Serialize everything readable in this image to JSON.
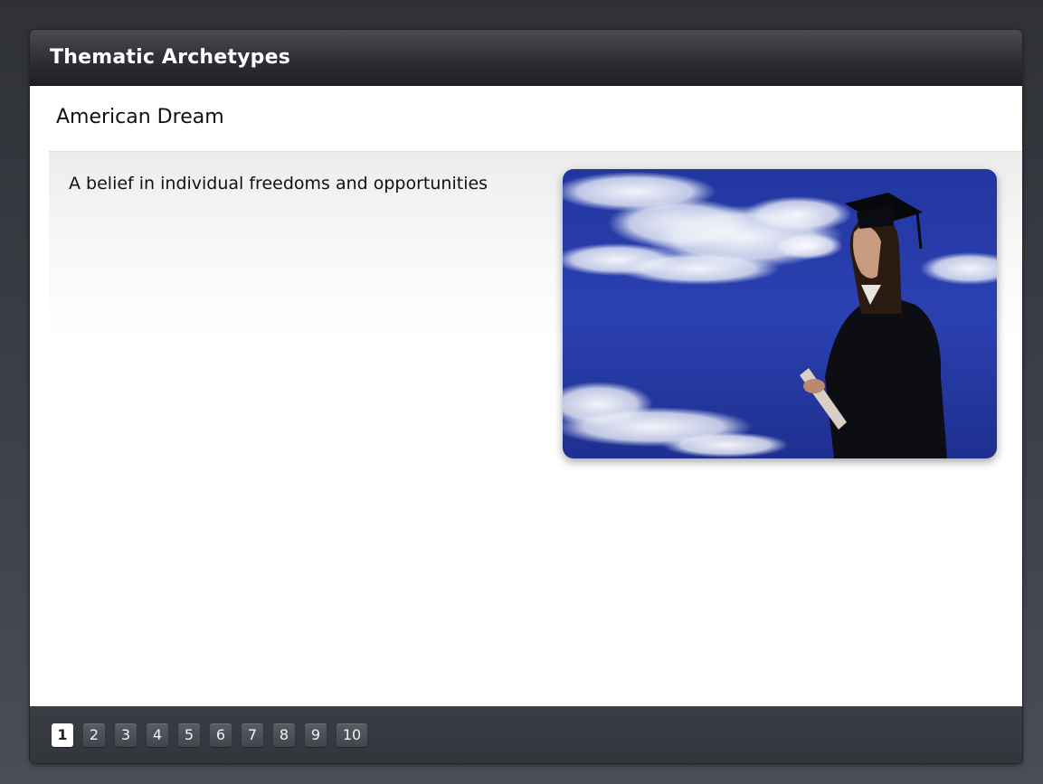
{
  "window": {
    "title": "Thematic Archetypes"
  },
  "slide": {
    "heading": "American Dream",
    "body": "A belief in individual freedoms and opportunities",
    "image": {
      "icon": "graduate-photo",
      "sky_color": "#2a3fa8",
      "cloud_color": "#ffffff"
    }
  },
  "pagination": {
    "current": "1",
    "pages": [
      "1",
      "2",
      "3",
      "4",
      "5",
      "6",
      "7",
      "8",
      "9",
      "10"
    ]
  }
}
